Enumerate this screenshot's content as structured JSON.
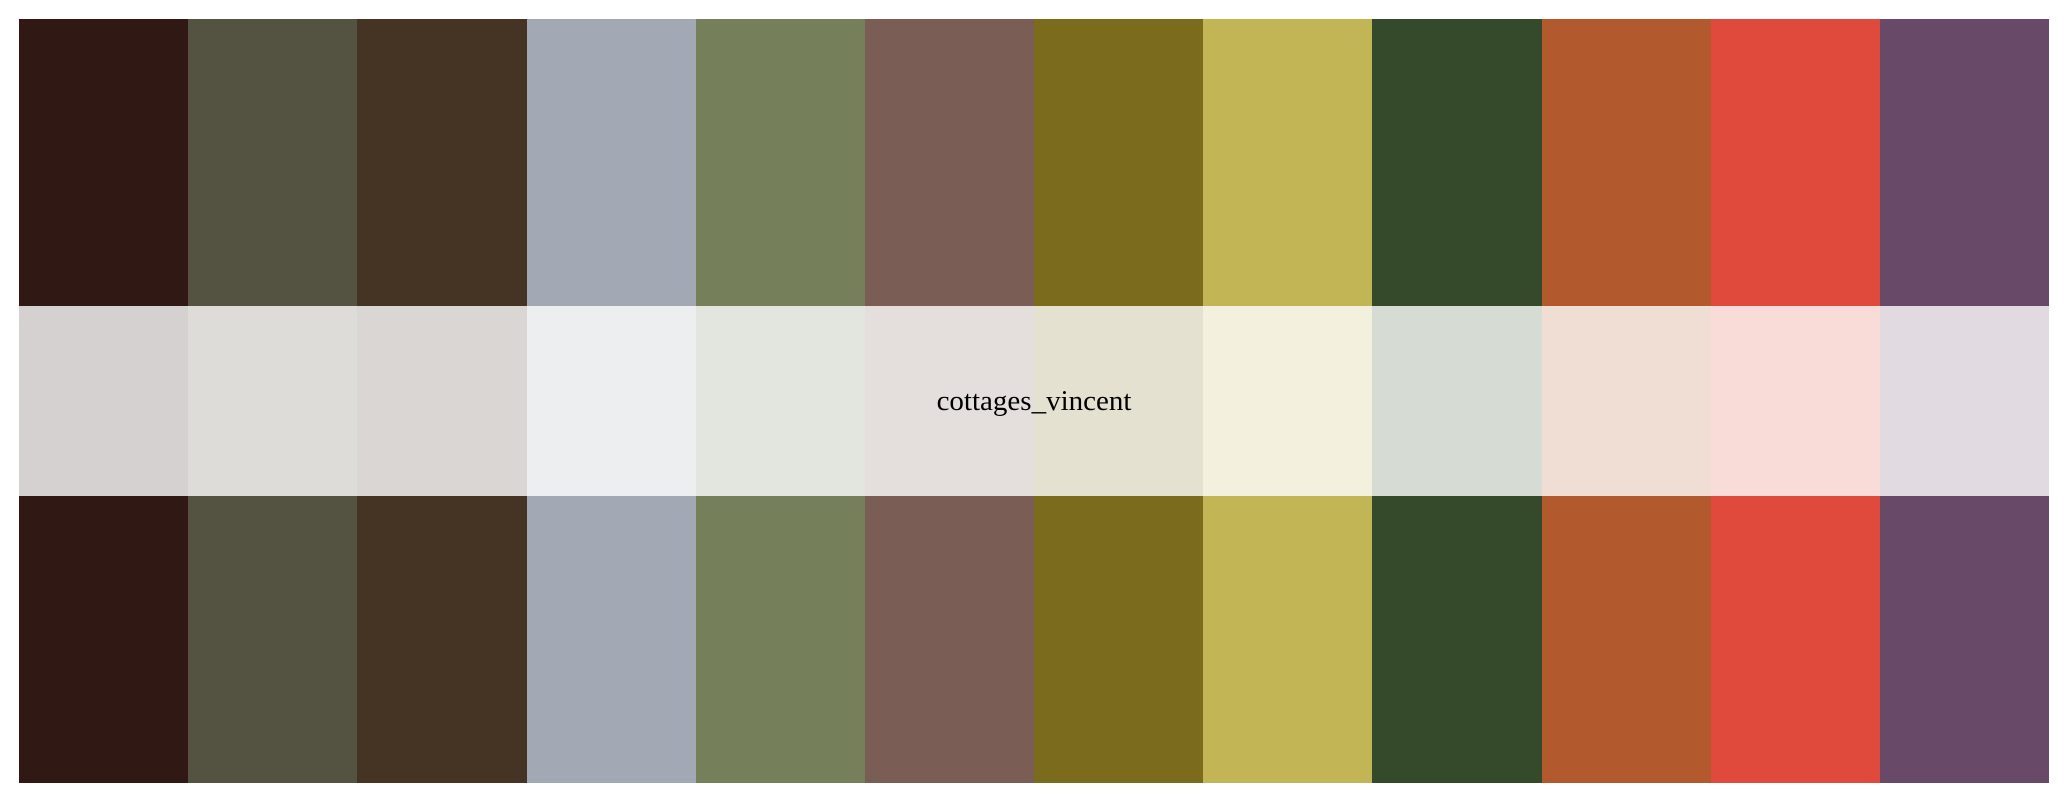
{
  "palette": {
    "name": "cottages_vincent",
    "colors": [
      "#301914",
      "#545341",
      "#453324",
      "#A3A9B4",
      "#75805B",
      "#7A5E55",
      "#7B6C1D",
      "#C1B556",
      "#344A2B",
      "#B3592E",
      "#E04A3D",
      "#684967"
    ]
  }
}
